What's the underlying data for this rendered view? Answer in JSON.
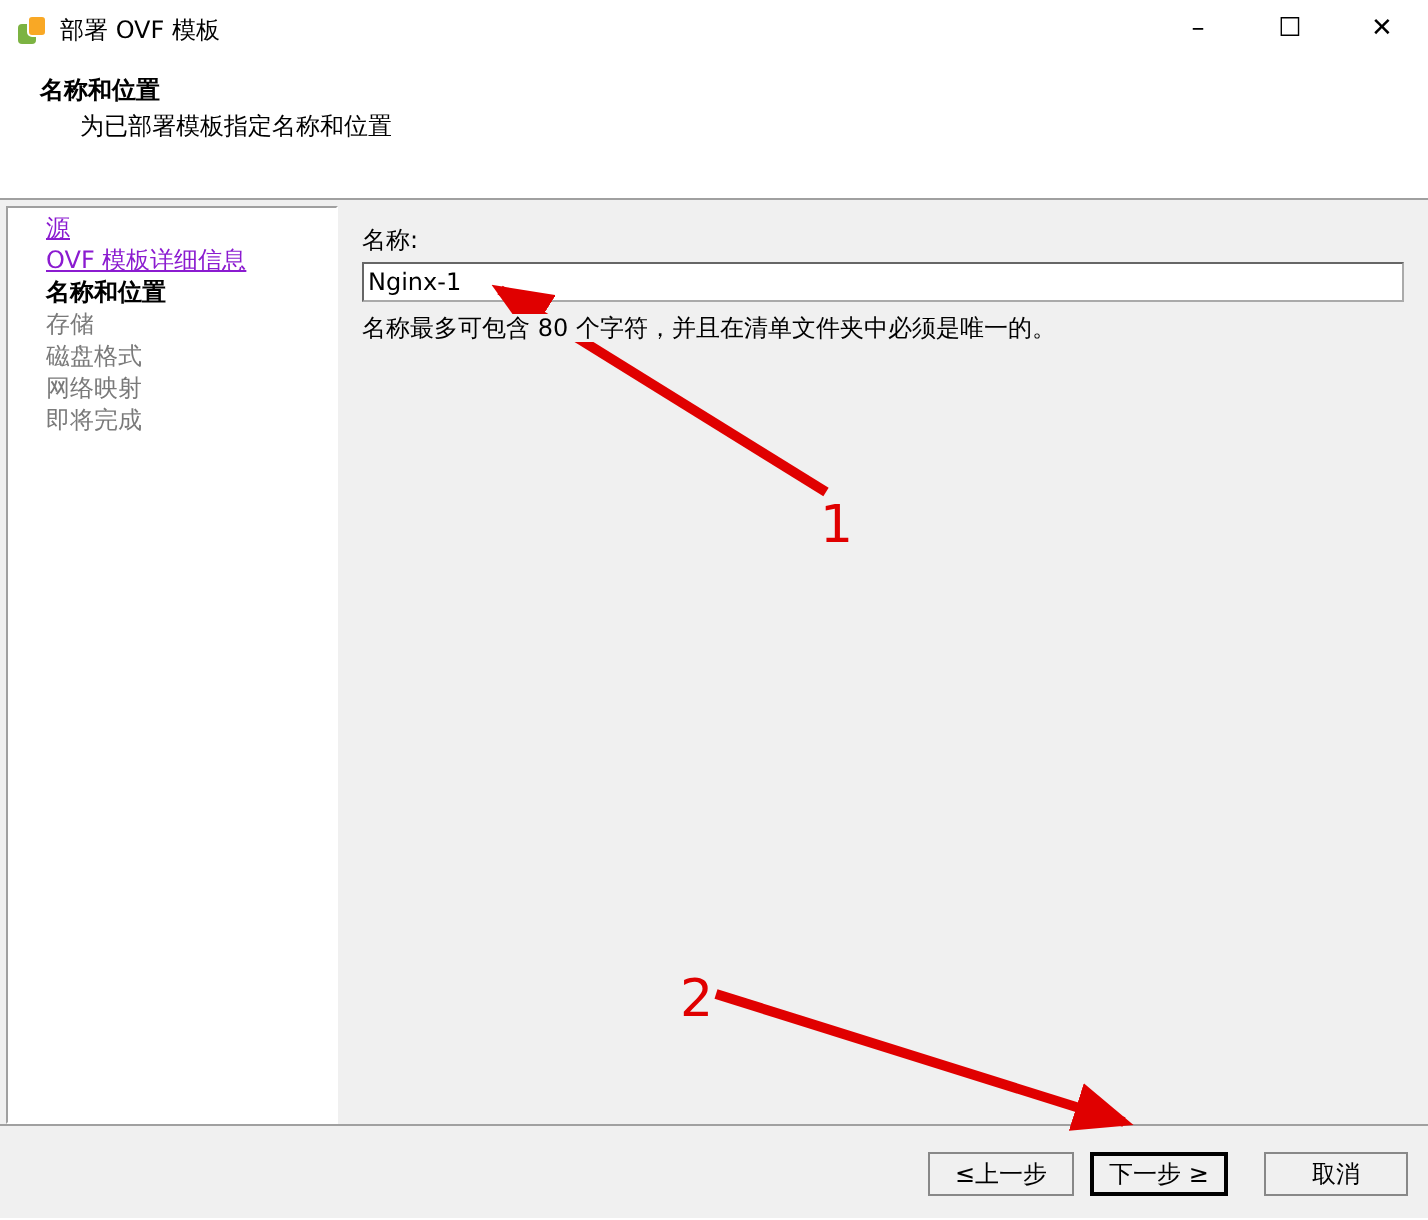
{
  "window": {
    "title": "部署 OVF 模板",
    "controls": [
      "–",
      "☐",
      "✕"
    ]
  },
  "header": {
    "title": "名称和位置",
    "subtitle": "为已部署模板指定名称和位置"
  },
  "steps": [
    {
      "label": "源",
      "visited": true,
      "selected": false
    },
    {
      "label": "OVF 模板详细信息",
      "visited": true,
      "selected": false
    },
    {
      "label": "名称和位置",
      "visited": false,
      "selected": true
    },
    {
      "label": "存储",
      "visited": false,
      "selected": false
    },
    {
      "label": "磁盘格式",
      "visited": false,
      "selected": false
    },
    {
      "label": "网络映射",
      "visited": false,
      "selected": false
    },
    {
      "label": "即将完成",
      "visited": false,
      "selected": false
    }
  ],
  "form": {
    "label": "名称:",
    "value": "Nginx-1",
    "hint": "名称最多可包含 80 个字符，并且在清单文件夹中必须是唯一的。"
  },
  "buttons": [
    {
      "label": "≤上一步",
      "kind": "back",
      "default": false
    },
    {
      "label": "下一步 ≥",
      "kind": "next",
      "default": true
    },
    {
      "label": "取消",
      "kind": "cancel",
      "default": false
    }
  ],
  "annotations": [
    "1",
    "2"
  ]
}
